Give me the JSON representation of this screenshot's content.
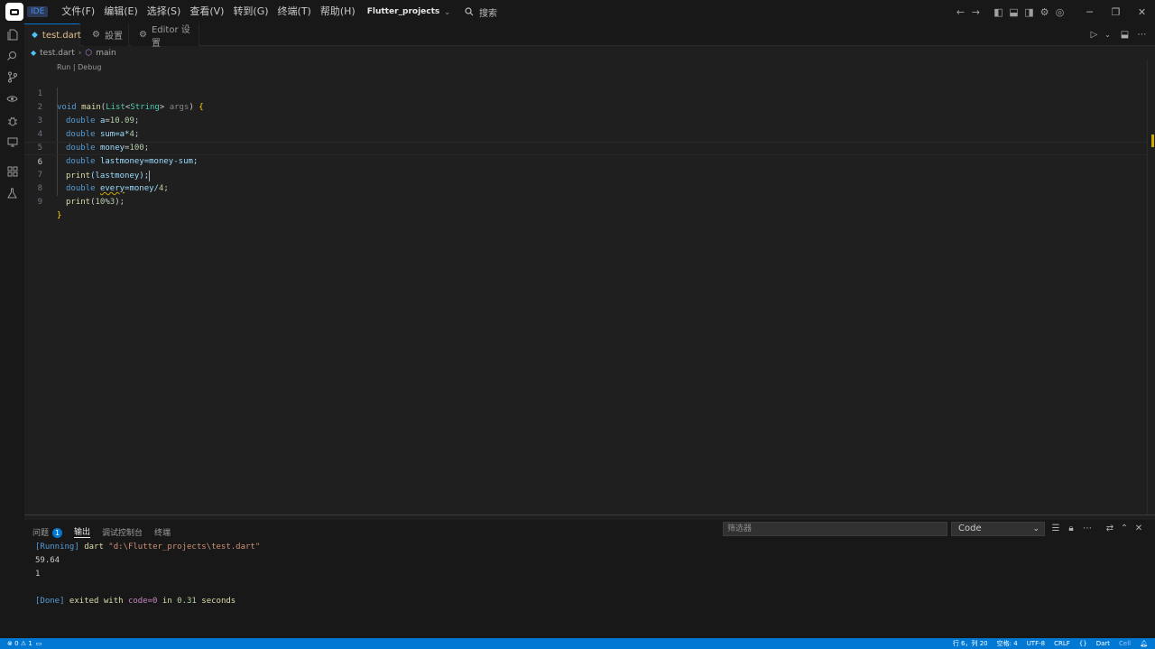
{
  "titlebar": {
    "ide_tag": "IDE",
    "menu": [
      "文件(F)",
      "编辑(E)",
      "选择(S)",
      "查看(V)",
      "转到(G)",
      "终端(T)",
      "帮助(H)"
    ],
    "project": "Flutter_projects",
    "search_label": "搜索",
    "window_controls": [
      "minimize",
      "restore",
      "close"
    ]
  },
  "activity_bar": {
    "icons": [
      "explorer-icon",
      "search-icon",
      "source-control-icon",
      "watch-icon",
      "debug-icon",
      "remote-icon",
      "extensions-icon",
      "testing-icon"
    ]
  },
  "tabs": [
    {
      "label": "test.dart",
      "active": true,
      "icon": "dart-icon"
    },
    {
      "label": "設置",
      "active": false,
      "icon": "gear-icon"
    },
    {
      "label": "Editor 设置",
      "active": false,
      "icon": "gear-icon"
    }
  ],
  "breadcrumb": {
    "file": "test.dart",
    "symbol": "main"
  },
  "editor": {
    "codelens": "Run | Debug",
    "line_numbers": [
      "1",
      "2",
      "3",
      "4",
      "5",
      "6",
      "7",
      "8",
      "9"
    ],
    "current_line": 6,
    "code": {
      "l1": {
        "kw": "void",
        "fn": "main",
        "open": "(",
        "type": "List",
        "lt": "<",
        "targ": "String",
        "gt": ">",
        "param": "args",
        "close": ") ",
        "brace": "{"
      },
      "l2": {
        "kw": "double",
        "name": "a",
        "eq": "=",
        "num": "10.09",
        "end": ";"
      },
      "l3": {
        "kw": "double",
        "name": "sum",
        "expr": "=a*",
        "num": "4",
        "end": ";"
      },
      "l4": {
        "kw": "double",
        "name": "money",
        "eq": "=",
        "num": "100",
        "end": ";"
      },
      "l5": {
        "kw": "double",
        "name": "lastmoney",
        "expr": "=money-sum;"
      },
      "l6": {
        "fn": "print",
        "args": "(lastmoney);"
      },
      "l7": {
        "kw": "double",
        "name": "every",
        "expr": "=money/",
        "num": "4",
        "end": ";"
      },
      "l8": {
        "fn": "print",
        "open": "(",
        "num1": "10",
        "op": "%",
        "num2": "3",
        "close": ");"
      },
      "l9": {
        "brace": "}"
      }
    }
  },
  "panel": {
    "tabs": [
      {
        "label": "问题",
        "badge": "1",
        "active": false
      },
      {
        "label": "输出",
        "active": true
      },
      {
        "label": "调试控制台",
        "active": false
      },
      {
        "label": "终端",
        "active": false
      }
    ],
    "filter_placeholder": "筛选器",
    "channel": "Code",
    "output": {
      "running_tag": "[Running]",
      "running_cmd": " dart ",
      "running_path": "\"d:\\Flutter_projects\\test.dart\"",
      "result1": "59.64",
      "result2": "1",
      "done_tag": "[Done]",
      "done_text1": " exited with ",
      "done_code": "code=0",
      "done_text2": " in ",
      "done_time": "0.31",
      "done_text3": " seconds"
    }
  },
  "statusbar": {
    "errors": "0",
    "warnings": "1",
    "position": "行 6，列 20",
    "spaces": "空格: 4",
    "encoding": "UTF-8",
    "eol": "CRLF",
    "braces": "{}",
    "language": "Dart",
    "extra": "Cell"
  },
  "colors": {
    "accent": "#0078d4",
    "editor_bg": "#1f1f1f",
    "chrome_bg": "#181818",
    "active_tab_text": "#e2c08d",
    "keyword": "#569cd6"
  }
}
